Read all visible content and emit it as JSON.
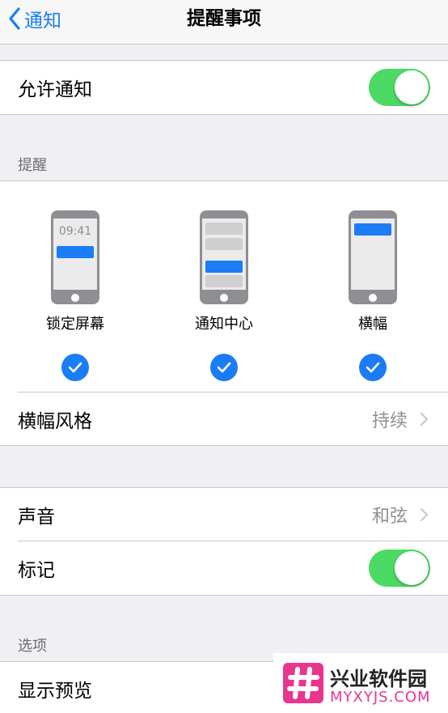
{
  "nav": {
    "back_label": "通知",
    "title": "提醒事项"
  },
  "allow_notifications": {
    "label": "允许通知",
    "enabled": true
  },
  "alerts_section": {
    "header": "提醒",
    "styles": [
      {
        "label": "锁定屏幕",
        "time": "09:41",
        "checked": true
      },
      {
        "label": "通知中心",
        "checked": true
      },
      {
        "label": "横幅",
        "checked": true
      }
    ]
  },
  "banner_style": {
    "label": "横幅风格",
    "value": "持续"
  },
  "sounds": {
    "label": "声音",
    "value": "和弦"
  },
  "badges": {
    "label": "标记",
    "enabled": true
  },
  "options_section": {
    "header": "选项"
  },
  "show_previews": {
    "label": "显示预览"
  },
  "watermark": {
    "name": "兴业软件园",
    "url": "MYXYJS.COM"
  },
  "colors": {
    "accent": "#1b7cf6",
    "toggle_on": "#4cd964",
    "background": "#efeff4"
  }
}
